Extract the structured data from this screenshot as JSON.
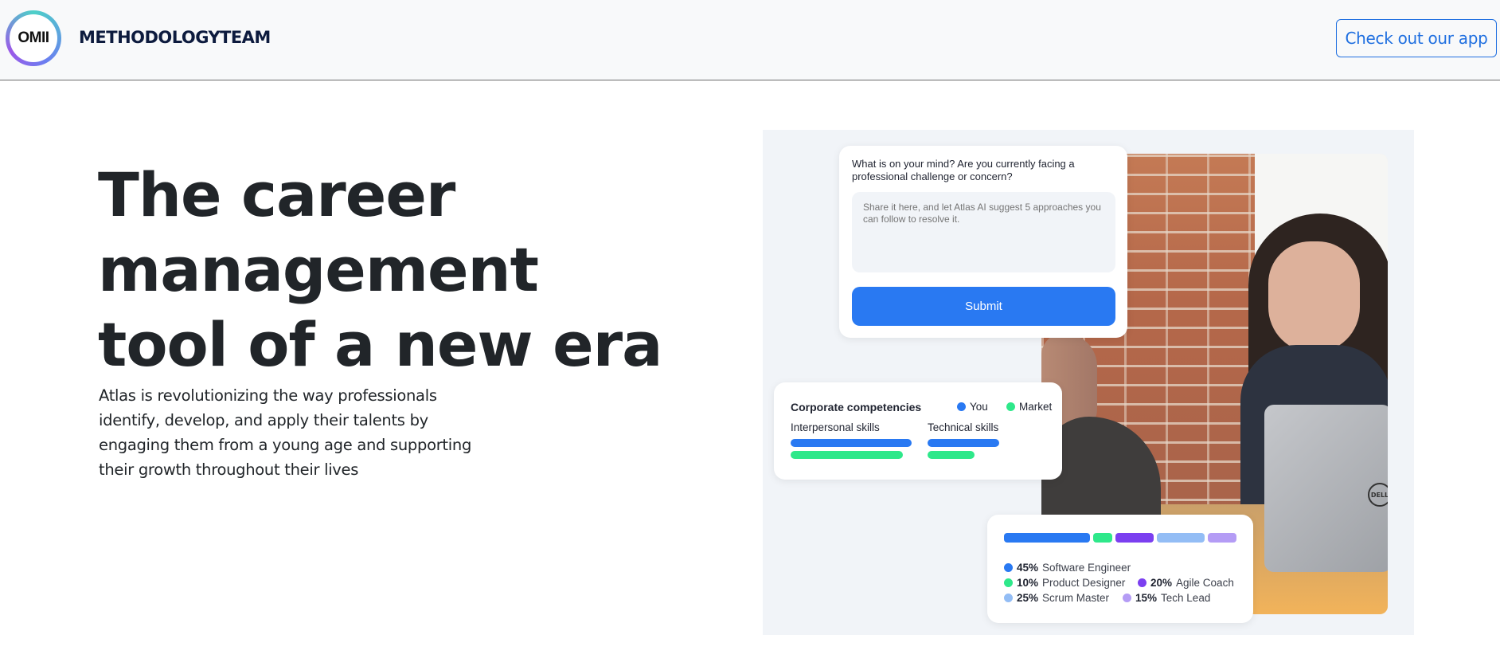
{
  "nav": {
    "logo_text": "OMII",
    "links": [
      "METHODOLOGY",
      "TEAM"
    ],
    "cta_label": "Check out our app"
  },
  "hero": {
    "title_lines": [
      "The career",
      "management",
      "tool of a new era"
    ],
    "description": "Atlas is revolutionizing the way professionals identify, develop, and apply their talents by engaging them from a young age and supporting their growth throughout their lives"
  },
  "illustration": {
    "question_card": {
      "label": "What is on your mind? Are you currently facing a professional challenge or concern?",
      "placeholder": "Share it here, and let Atlas AI suggest 5 approaches you can follow to resolve it.",
      "submit_label": "Submit"
    },
    "competencies_card": {
      "title": "Corporate competencies",
      "legend": [
        {
          "label": "You",
          "color": "#2979f2"
        },
        {
          "label": "Market",
          "color": "#2ee88a"
        }
      ],
      "groups": [
        {
          "label": "Interpersonal skills",
          "you": 1.0,
          "market": 0.93
        },
        {
          "label": "Technical skills",
          "you": 0.59,
          "market": 0.39
        }
      ]
    },
    "roles_card": {
      "roles": [
        {
          "percent": "45%",
          "name": "Software Engineer",
          "value": 45,
          "color": "#2979f2"
        },
        {
          "percent": "10%",
          "name": "Product Designer",
          "value": 10,
          "color": "#2ee88a"
        },
        {
          "percent": "20%",
          "name": "Agile Coach",
          "value": 20,
          "color": "#7b3ff0"
        },
        {
          "percent": "25%",
          "name": "Scrum Master",
          "value": 25,
          "color": "#93bdf5"
        },
        {
          "percent": "15%",
          "name": "Tech Lead",
          "value": 15,
          "color": "#b49cf5"
        }
      ]
    },
    "laptop_logo": "DELL"
  }
}
